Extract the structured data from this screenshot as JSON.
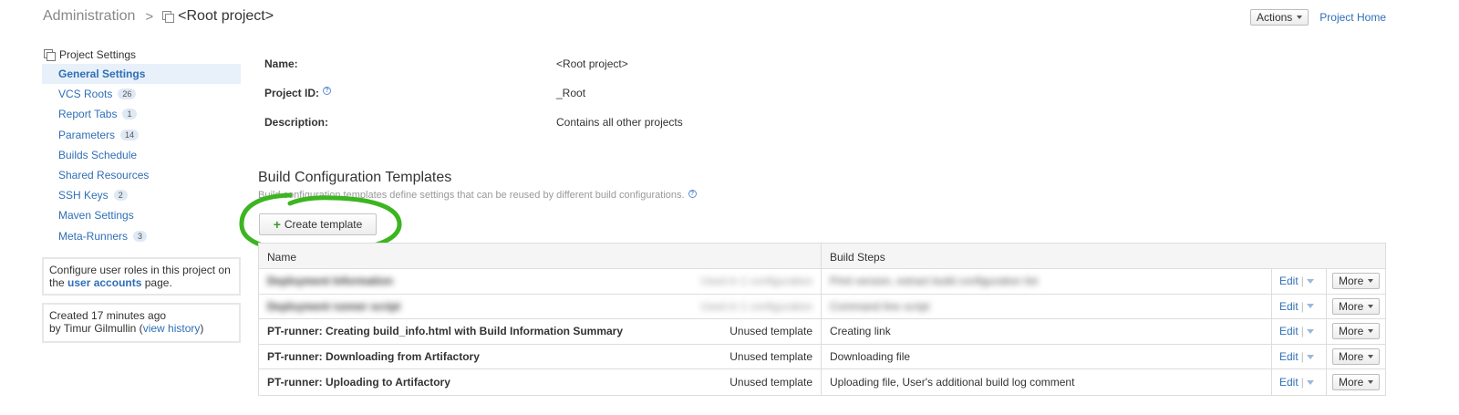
{
  "breadcrumb": {
    "root": "Administration",
    "separator": ">",
    "current": "<Root project>"
  },
  "header": {
    "actions_label": "Actions",
    "project_home_label": "Project Home"
  },
  "sidebar": {
    "title": "Project Settings",
    "items": [
      {
        "label": "General Settings",
        "badge": ""
      },
      {
        "label": "VCS Roots",
        "badge": "26"
      },
      {
        "label": "Report Tabs",
        "badge": "1"
      },
      {
        "label": "Parameters",
        "badge": "14"
      },
      {
        "label": "Builds Schedule",
        "badge": ""
      },
      {
        "label": "Shared Resources",
        "badge": ""
      },
      {
        "label": "SSH Keys",
        "badge": "2"
      },
      {
        "label": "Maven Settings",
        "badge": ""
      },
      {
        "label": "Meta-Runners",
        "badge": "3"
      }
    ],
    "roles_box": {
      "prefix": "Configure user roles in this project on the",
      "link": "user accounts",
      "suffix": "page."
    },
    "history_box": {
      "line1": "Created 17 minutes ago",
      "prefix": "by Timur Gilmullin (",
      "link": "view history",
      "suffix": ")"
    }
  },
  "project_info": {
    "name_label": "Name:",
    "name_value": "<Root project>",
    "id_label": "Project ID:",
    "id_value": "_Root",
    "desc_label": "Description:",
    "desc_value": "Contains all other projects"
  },
  "templates_section": {
    "title": "Build Configuration Templates",
    "description": "Build configuration templates define settings that can be reused by different build configurations.",
    "create_button": "Create template",
    "annotation_color": "#3cb521",
    "columns": {
      "name": "Name",
      "build_steps": "Build Steps"
    },
    "rows": [
      {
        "name": "Deployment Information",
        "status": "Used in 1 configuration",
        "steps": "Print version, extract build configuration list",
        "blurred": true
      },
      {
        "name": "Deployment runner script",
        "status": "Used in 1 configuration",
        "steps": "Command line script",
        "blurred": true
      },
      {
        "name": "PT-runner: Creating build_info.html with Build Information Summary",
        "status": "Unused template",
        "steps": "Creating link",
        "blurred": false
      },
      {
        "name": "PT-runner: Downloading from Artifactory",
        "status": "Unused template",
        "steps": "Downloading file",
        "blurred": false
      },
      {
        "name": "PT-runner: Uploading to Artifactory",
        "status": "Unused template",
        "steps": "Uploading file, User's additional build log comment",
        "blurred": false
      }
    ],
    "edit_label": "Edit",
    "more_label": "More"
  }
}
